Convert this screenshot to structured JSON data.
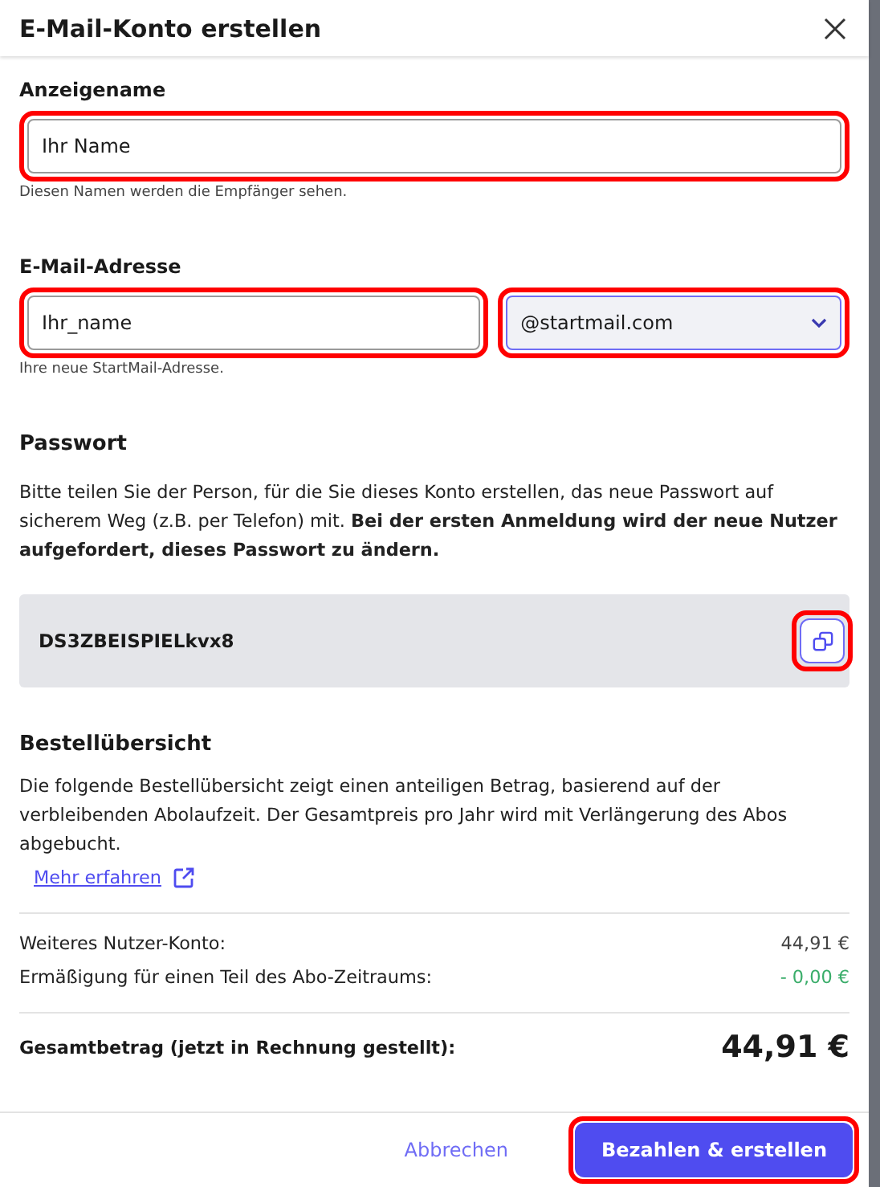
{
  "dialog": {
    "title": "E-Mail-Konto erstellen"
  },
  "display_name": {
    "label": "Anzeigename",
    "value": "Ihr Name",
    "hint": "Diesen Namen werden die Empfänger sehen.",
    "highlighted": true
  },
  "email": {
    "label": "E-Mail-Adresse",
    "value": "Ihr_name",
    "domain": "@startmail.com",
    "hint": "Ihre neue StartMail-Adresse.",
    "highlighted": true,
    "domain_highlighted": true
  },
  "password": {
    "heading": "Passwort",
    "text": "Bitte teilen Sie der Person, für die Sie dieses Konto erstellen, das neue Passwort auf sicherem Weg (z.B. per Telefon) mit. **Bei der ersten Anmeldung wird der neue Nutzer aufgefordert, dieses Passwort zu ändern.**",
    "value": "DS3ZBEISPIELkvx8",
    "copy_highlighted": true
  },
  "order": {
    "heading": "Bestellübersicht",
    "text": "Die folgende Bestellübersicht zeigt einen anteiligen Betrag, basierend auf der verbleibenden Abolaufzeit. Der Gesamtpreis pro Jahr wird mit Verlängerung des Abos abgebucht.",
    "link": "Mehr erfahren",
    "rows": [
      {
        "label": "Weiteres Nutzer-Konto:",
        "amount": "44,91 €",
        "kind": "charge"
      },
      {
        "label": "Ermäßigung für einen Teil des Abo-Zeitraums:",
        "amount": "- 0,00 €",
        "kind": "discount"
      }
    ],
    "total_label": "Gesamtbetrag (jetzt in Rechnung gestellt):",
    "total": "44,91 €"
  },
  "buttons": [
    {
      "label": "Abbrechen",
      "kind": "secondary",
      "highlighted": false
    },
    {
      "label": "Bezahlen & erstellen",
      "kind": "primary",
      "highlighted": true
    }
  ]
}
